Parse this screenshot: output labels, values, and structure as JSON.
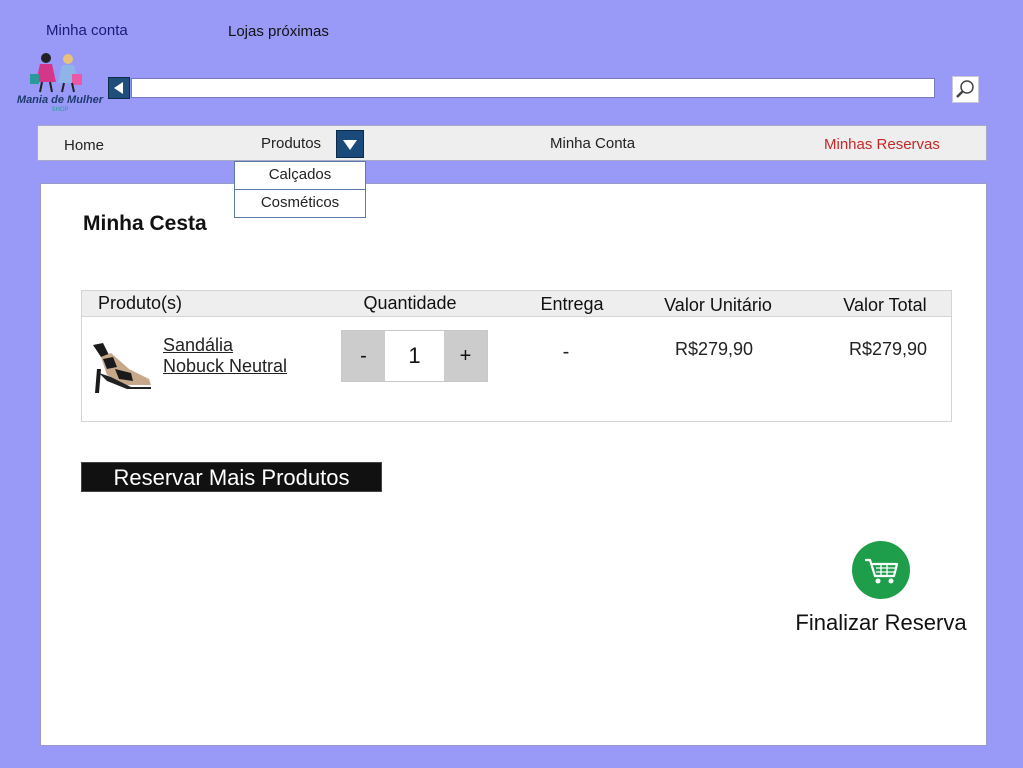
{
  "top_links": {
    "account": "Minha conta",
    "stores": "Lojas próximas"
  },
  "logo": {
    "name": "Mania de Mulher",
    "tagline": "SHOP"
  },
  "search": {
    "value": "",
    "placeholder": ""
  },
  "nav": {
    "home": "Home",
    "products": "Produtos",
    "account": "Minha Conta",
    "reservations": "Minhas Reservas"
  },
  "dropdown": {
    "items": [
      "Calçados",
      "Cosméticos"
    ]
  },
  "basket": {
    "title": "Minha Cesta",
    "columns": [
      "Produto(s)",
      "Quantidade",
      "Entrega",
      "Valor Unitário",
      "Valor Total"
    ],
    "row": {
      "name_line1": "Sandália",
      "name_line2": "Nobuck Neutral",
      "minus": "-",
      "quantity": "1",
      "plus": "+",
      "delivery": "-",
      "unit_price": "R$279,90",
      "total_price": "R$279,90"
    }
  },
  "actions": {
    "reserve_more": "Reservar Mais Produtos",
    "finalize": "Finalizar Reserva"
  },
  "colors": {
    "background": "#9999f8",
    "accent": "#1a4a7a",
    "cart": "#1e9e4a",
    "reservations_link": "#c62828"
  }
}
